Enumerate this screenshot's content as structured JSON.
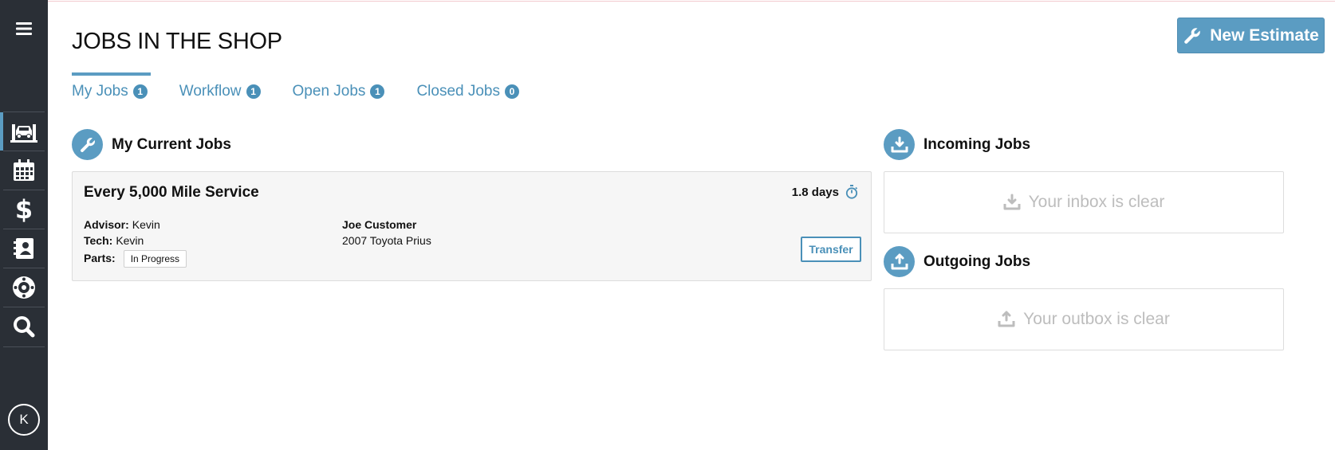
{
  "sidebar": {
    "menu_icon": "hamburger-icon",
    "items": [
      {
        "name": "shop",
        "icon": "garage-lift-icon",
        "active": true
      },
      {
        "name": "calendar",
        "icon": "calendar-icon",
        "active": false
      },
      {
        "name": "billing",
        "icon": "dollar-icon",
        "active": false
      },
      {
        "name": "contacts",
        "icon": "address-book-icon",
        "active": false
      },
      {
        "name": "parts",
        "icon": "tire-icon",
        "active": false
      },
      {
        "name": "search",
        "icon": "search-icon",
        "active": false
      }
    ],
    "avatar_initial": "K"
  },
  "header": {
    "title": "JOBS IN THE SHOP",
    "new_estimate_label": "New Estimate"
  },
  "tabs": [
    {
      "label": "My Jobs",
      "count": "1",
      "active": true
    },
    {
      "label": "Workflow",
      "count": "1",
      "active": false
    },
    {
      "label": "Open Jobs",
      "count": "1",
      "active": false
    },
    {
      "label": "Closed Jobs",
      "count": "0",
      "active": false
    }
  ],
  "current_jobs": {
    "title": "My Current Jobs",
    "jobs": [
      {
        "title": "Every 5,000 Mile Service",
        "elapsed": "1.8 days",
        "advisor_label": "Advisor:",
        "advisor": "Kevin",
        "tech_label": "Tech:",
        "tech": "Kevin",
        "parts_label": "Parts:",
        "parts_status": "In Progress",
        "customer": "Joe Customer",
        "vehicle": "2007 Toyota Prius",
        "transfer_label": "Transfer"
      }
    ]
  },
  "incoming": {
    "title": "Incoming Jobs",
    "empty_text": "Your inbox is clear"
  },
  "outgoing": {
    "title": "Outgoing Jobs",
    "empty_text": "Your outbox is clear"
  },
  "colors": {
    "accent": "#5b9cc2",
    "link": "#4a90b8",
    "sidebar": "#2a2f36"
  }
}
